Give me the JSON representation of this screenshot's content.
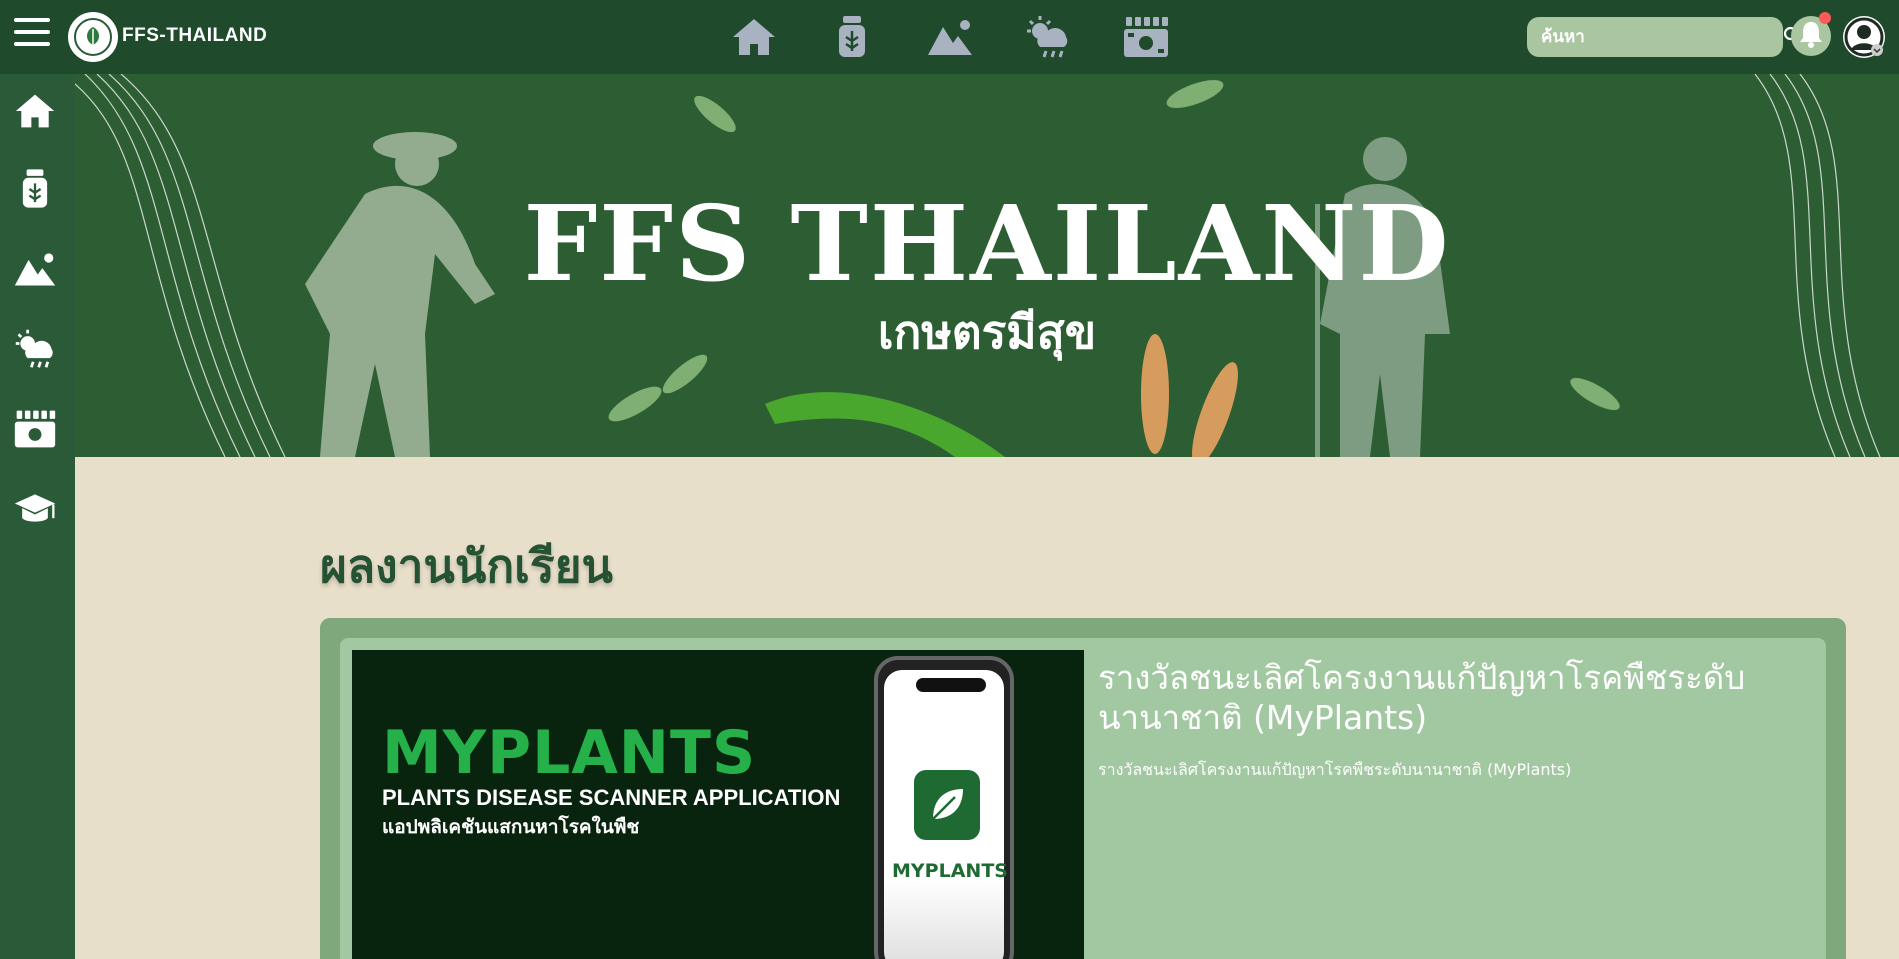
{
  "header": {
    "brand": "FFS-THAILAND",
    "search_placeholder": "ค้นหา"
  },
  "hero": {
    "title": "FFS THAILAND",
    "subtitle": "เกษตรมีสุข"
  },
  "section": {
    "title": "ผลงานนักเรียน"
  },
  "card": {
    "image": {
      "title": "MYPLANTS",
      "subtitle": "PLANTS DISEASE SCANNER APPLICATION",
      "thai": "แอปพลิเคชันแสกนหาโรคในพืช",
      "app_name": "MYPLANTS"
    },
    "title": "รางวัลชนะเลิศโครงงานแก้ปัญหาโรคพืชระดับนานาชาติ (MyPlants)",
    "description": "รางวัลชนะเลิศโครงงานแก้ปัญหาโรคพืชระดับนานาชาติ (MyPlants)"
  },
  "colors": {
    "topbar": "#1f4a2c",
    "sidebar": "#2a5a38",
    "page_bg": "#e8dfca",
    "card_outer": "#7fa87c",
    "card_inner": "#a2c8a1",
    "nav_icon": "#a9b2c0",
    "notification_dot": "#ff5a5a"
  },
  "icons": {
    "top_nav": [
      "home-icon",
      "seed-jar-icon",
      "landscape-icon",
      "weather-icon",
      "money-icon"
    ],
    "sidebar": [
      "home-icon",
      "seed-jar-icon",
      "landscape-icon",
      "weather-icon",
      "money-icon",
      "graduation-cap-icon"
    ]
  }
}
